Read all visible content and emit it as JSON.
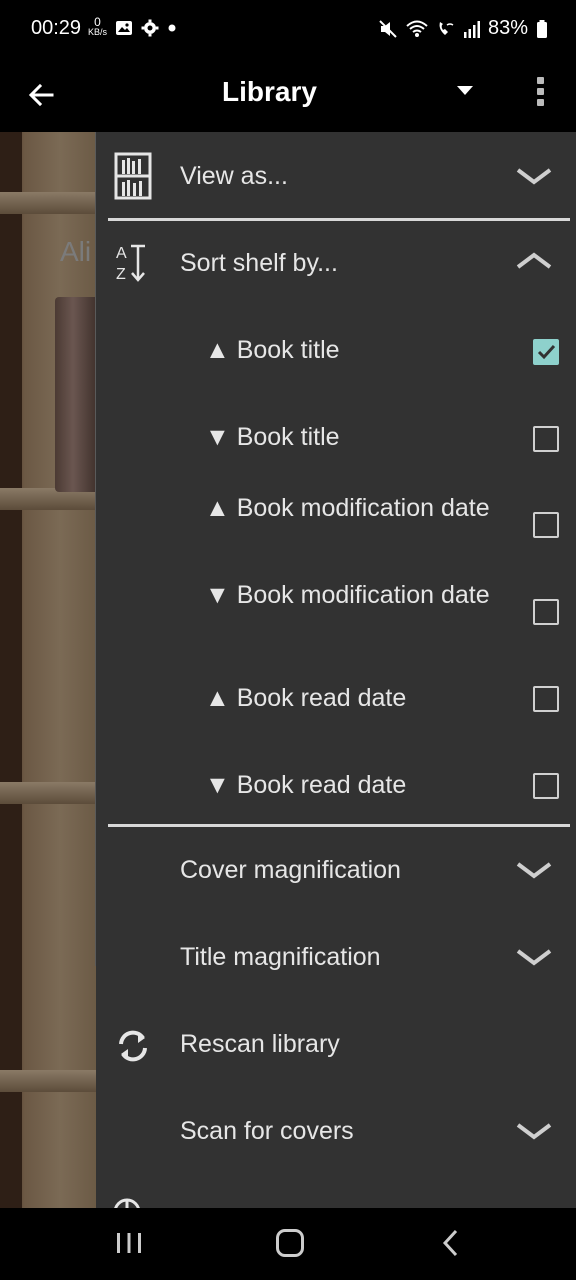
{
  "status_bar": {
    "time": "00:29",
    "speed_value": "0",
    "speed_unit": "KB/s",
    "battery": "83%"
  },
  "app_bar": {
    "title": "Library"
  },
  "background": {
    "shelf_book_text": "Ali"
  },
  "drawer": {
    "view_as_label": "View as...",
    "sort_shelf_label": "Sort shelf by...",
    "sort_options": [
      {
        "label": "▲ Book title",
        "checked": true
      },
      {
        "label": "▼ Book title",
        "checked": false
      },
      {
        "label": "▲ Book modification date",
        "checked": false
      },
      {
        "label": "▼ Book modification date",
        "checked": false
      },
      {
        "label": "▲ Book read date",
        "checked": false
      },
      {
        "label": "▼ Book read date",
        "checked": false
      }
    ],
    "cover_magnification_label": "Cover magnification",
    "title_magnification_label": "Title magnification",
    "rescan_library_label": "Rescan library",
    "scan_for_covers_label": "Scan for covers"
  },
  "colors": {
    "drawer_bg": "#323232",
    "check_accent": "#8ed1cc"
  }
}
